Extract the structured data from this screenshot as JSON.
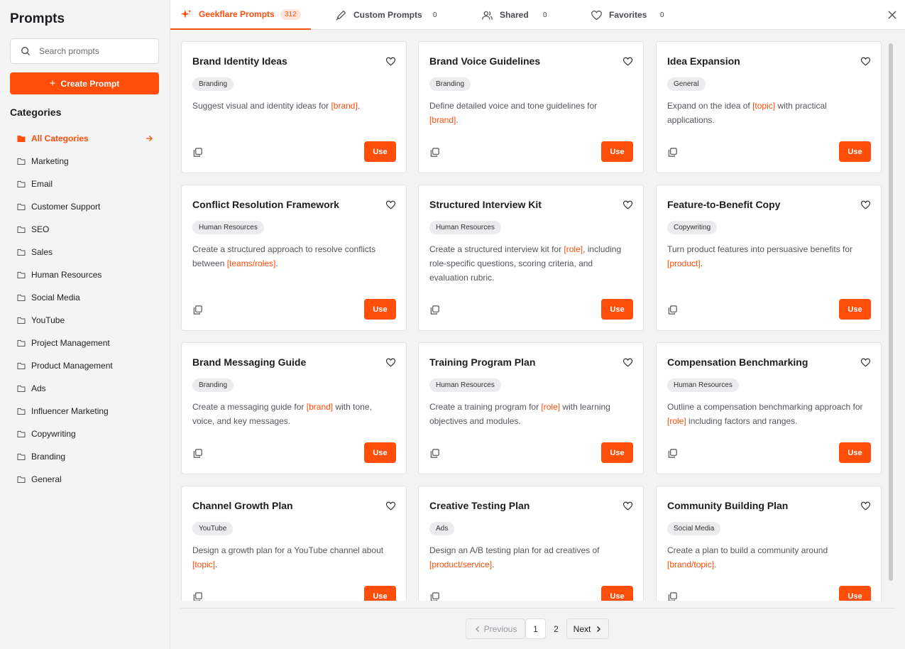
{
  "sidebar": {
    "title": "Prompts",
    "search_placeholder": "Search prompts",
    "create_label": "Create Prompt",
    "categories_title": "Categories",
    "categories": [
      {
        "label": "All Categories",
        "active": true
      },
      {
        "label": "Marketing"
      },
      {
        "label": "Email"
      },
      {
        "label": "Customer Support"
      },
      {
        "label": "SEO"
      },
      {
        "label": "Sales"
      },
      {
        "label": "Human Resources"
      },
      {
        "label": "Social Media"
      },
      {
        "label": "YouTube"
      },
      {
        "label": "Project Management"
      },
      {
        "label": "Product Management"
      },
      {
        "label": "Ads"
      },
      {
        "label": "Influencer Marketing"
      },
      {
        "label": "Copywriting"
      },
      {
        "label": "Branding"
      },
      {
        "label": "General"
      }
    ]
  },
  "tabs": [
    {
      "label": "Geekflare Prompts",
      "count": "312",
      "icon": "sparkle-icon",
      "active": true
    },
    {
      "label": "Custom Prompts",
      "count": "0",
      "icon": "pen-icon"
    },
    {
      "label": "Shared",
      "count": "0",
      "icon": "users-icon"
    },
    {
      "label": "Favorites",
      "count": "0",
      "icon": "heart-icon"
    }
  ],
  "cards": [
    {
      "title": "Brand Identity Ideas",
      "tag": "Branding",
      "desc": [
        [
          "Suggest visual and identity ideas for ",
          false
        ],
        [
          "[brand]",
          true
        ],
        [
          ".",
          false
        ]
      ],
      "use_label": "Use"
    },
    {
      "title": "Brand Voice Guidelines",
      "tag": "Branding",
      "desc": [
        [
          "Define detailed voice and tone guidelines for ",
          false
        ],
        [
          "[brand]",
          true
        ],
        [
          ".",
          false
        ]
      ],
      "use_label": "Use"
    },
    {
      "title": "Idea Expansion",
      "tag": "General",
      "desc": [
        [
          "Expand on the idea of ",
          false
        ],
        [
          "[topic]",
          true
        ],
        [
          " with practical applications.",
          false
        ]
      ],
      "use_label": "Use"
    },
    {
      "title": "Conflict Resolution Framework",
      "tag": "Human Resources",
      "desc": [
        [
          "Create a structured approach to resolve conflicts between ",
          false
        ],
        [
          "[teams/roles]",
          true
        ],
        [
          ".",
          false
        ]
      ],
      "use_label": "Use"
    },
    {
      "title": "Structured Interview Kit",
      "tag": "Human Resources",
      "desc": [
        [
          "Create a structured interview kit for ",
          false
        ],
        [
          "[role]",
          true
        ],
        [
          ", including role-specific questions, scoring criteria, and evaluation rubric.",
          false
        ]
      ],
      "use_label": "Use"
    },
    {
      "title": "Feature-to-Benefit Copy",
      "tag": "Copywriting",
      "desc": [
        [
          "Turn product features into persuasive benefits for ",
          false
        ],
        [
          "[product]",
          true
        ],
        [
          ".",
          false
        ]
      ],
      "use_label": "Use"
    },
    {
      "title": "Brand Messaging Guide",
      "tag": "Branding",
      "desc": [
        [
          "Create a messaging guide for ",
          false
        ],
        [
          "[brand]",
          true
        ],
        [
          " with tone, voice, and key messages.",
          false
        ]
      ],
      "use_label": "Use"
    },
    {
      "title": "Training Program Plan",
      "tag": "Human Resources",
      "desc": [
        [
          "Create a training program for ",
          false
        ],
        [
          "[role]",
          true
        ],
        [
          " with learning objectives and modules.",
          false
        ]
      ],
      "use_label": "Use"
    },
    {
      "title": "Compensation Benchmarking",
      "tag": "Human Resources",
      "desc": [
        [
          "Outline a compensation benchmarking approach for ",
          false
        ],
        [
          "[role]",
          true
        ],
        [
          " including factors and ranges.",
          false
        ]
      ],
      "use_label": "Use"
    },
    {
      "title": "Channel Growth Plan",
      "tag": "YouTube",
      "desc": [
        [
          "Design a growth plan for a YouTube channel about ",
          false
        ],
        [
          "[topic]",
          true
        ],
        [
          ".",
          false
        ]
      ],
      "use_label": "Use"
    },
    {
      "title": "Creative Testing Plan",
      "tag": "Ads",
      "desc": [
        [
          "Design an A/B testing plan for ad creatives of ",
          false
        ],
        [
          "[product/service]",
          true
        ],
        [
          ".",
          false
        ]
      ],
      "use_label": "Use"
    },
    {
      "title": "Community Building Plan",
      "tag": "Social Media",
      "desc": [
        [
          "Create a plan to build a community around ",
          false
        ],
        [
          "[brand/topic]",
          true
        ],
        [
          ".",
          false
        ]
      ],
      "use_label": "Use"
    }
  ],
  "pagination": {
    "previous_label": "Previous",
    "pages": [
      "1",
      "2"
    ],
    "current": "1",
    "next_label": "Next"
  },
  "colors": {
    "accent": "#ff4d0a"
  }
}
